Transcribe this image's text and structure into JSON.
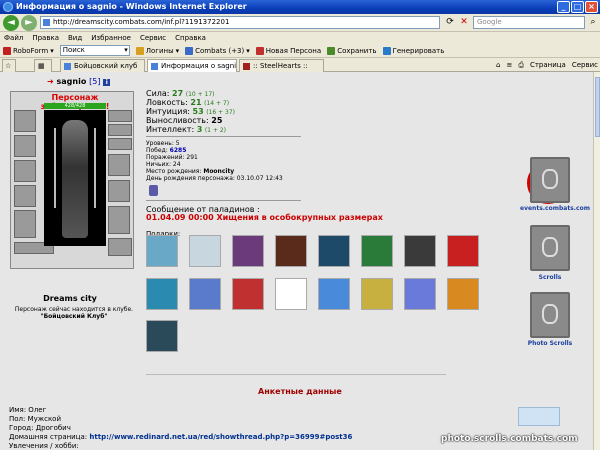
{
  "window": {
    "title": "Информация о sagnio - Windows Internet Explorer"
  },
  "address": {
    "url": "http://dreamscity.combats.com/inf.pl?1191372201",
    "search_placeholder": "Google"
  },
  "menu": [
    "Файл",
    "Правка",
    "Вид",
    "Избранное",
    "Сервис",
    "Справка"
  ],
  "toolbar": {
    "roboform": "RoboForm",
    "search_value": "Поиск",
    "logins": "Логины",
    "combats": "Combats (+3)",
    "new_persona": "Новая Персона",
    "save": "Сохранить",
    "generate": "Генерировать"
  },
  "tabs": [
    "Бойцовский клуб",
    "Информация о sagnio",
    ":: SteelHearts ::"
  ],
  "cmdbar": {
    "page": "Страница",
    "service": "Сервис"
  },
  "character": {
    "name": "sagnio",
    "level": "[5]",
    "blocked": "Персонаж заблокирован!",
    "hp": "428/428",
    "city": "Dreams city",
    "status_line": "Персонаж сейчас находится в клубе.",
    "club": "\"Бойцовский Клуб\""
  },
  "stats": [
    {
      "label": "Сила:",
      "value": "27",
      "bonus": "(10 + 17)"
    },
    {
      "label": "Ловкость:",
      "value": "21",
      "bonus": "(14 + 7)"
    },
    {
      "label": "Интуиция:",
      "value": "53",
      "bonus": "(16 + 37)"
    },
    {
      "label": "Выносливость:",
      "value": "25",
      "bonus": ""
    },
    {
      "label": "Интеллект:",
      "value": "3",
      "bonus": "(1 + 2)"
    }
  ],
  "info": {
    "level": "Уровень: 5",
    "wins_label": "Побед:",
    "wins": "6285",
    "losses": "Поражений: 291",
    "draws": "Ничьих: 24",
    "birthplace_label": "Место рождения:",
    "birthplace": "Mooncity",
    "birthday": "День рождения персонажа: 03.10.07 12:43"
  },
  "message": {
    "title": "Сообщение от паладинов :",
    "text": "01.04.09 00:00 Хищения в особокрупных размерах"
  },
  "gifts_label": "Подарки:",
  "gift_colors": [
    "#6AA8C8",
    "#C8D6E0",
    "#6A3A7A",
    "#5A2A1A",
    "#1E4A6A",
    "#2A7A3A",
    "#3A3A3A",
    "#C82020",
    "#2A8AB0",
    "#5A7ACC",
    "#C03030",
    "#ffffff",
    "#4A8ADA",
    "#C8B040",
    "#6A7ADA",
    "#D88A20",
    "#2A4A5A"
  ],
  "right": {
    "events": "events.combats.com",
    "scrolls": "Scrolls",
    "photo": "Photo Scrolls"
  },
  "profile": {
    "heading": "Анкетные данные",
    "name": "Имя: Олег",
    "sex": "Пол: Мужской",
    "city": "Город: Дрогобич",
    "homepage_label": "Домашняя страница:",
    "homepage": "http://www.redinard.net.ua/red/showthread.php?p=36999#post36",
    "hobby": "Увлечения / хобби:"
  },
  "watermark": "photo.scrolls.combats.com"
}
